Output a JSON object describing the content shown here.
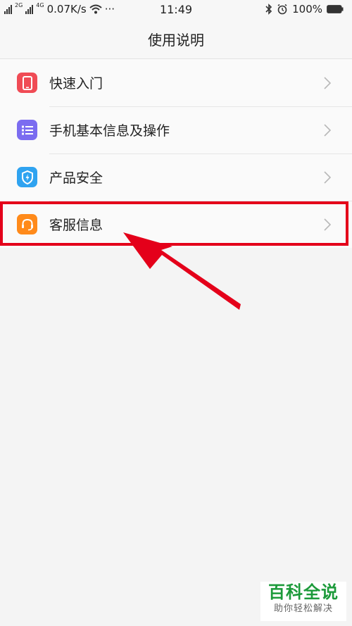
{
  "status_bar": {
    "network_1": "2G",
    "network_2": "4G",
    "speed": "0.07K/s",
    "more": "···",
    "time": "11:49",
    "battery": "100%"
  },
  "header": {
    "title": "使用说明"
  },
  "menu": [
    {
      "label": "快速入门",
      "icon": "phone-icon",
      "color": "#f04b55"
    },
    {
      "label": "手机基本信息及操作",
      "icon": "list-icon",
      "color": "#7b6cf0"
    },
    {
      "label": "产品安全",
      "icon": "shield-icon",
      "color": "#2fa3f0"
    },
    {
      "label": "客服信息",
      "icon": "headset-icon",
      "color": "#ff8a1a"
    }
  ],
  "annotation": {
    "highlight_color": "#e4001a"
  },
  "watermark": {
    "title": "百科全说",
    "subtitle": "助你轻松解决"
  }
}
